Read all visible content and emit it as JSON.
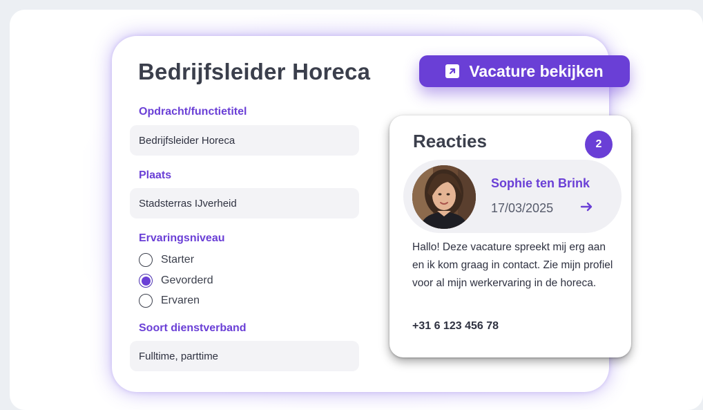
{
  "job": {
    "title": "Bedrijfsleider Horeca",
    "view_button_label": "Vacature bekijken"
  },
  "fields": {
    "functie_label": "Opdracht/functietitel",
    "functie_value": "Bedrijfsleider Horeca",
    "plaats_label": "Plaats",
    "plaats_value": "Stadsterras IJverheid",
    "ervaring_label": "Ervaringsniveau",
    "ervaring_options": [
      "Starter",
      "Gevorderd",
      "Ervaren"
    ],
    "ervaring_selected": "Gevorderd",
    "dienstverband_label": "Soort dienstverband",
    "dienstverband_value": "Fulltime, parttime"
  },
  "reacties": {
    "title": "Reacties",
    "count": "2",
    "person": {
      "name": "Sophie ten Brink",
      "date": "17/03/2025"
    },
    "message": "Hallo! Deze vacature spreekt mij erg aan en ik kom graag in contact. Zie mijn profiel voor al mijn werkervaring in de horeca.",
    "phone": "+31 6 123 456 78"
  },
  "colors": {
    "accent": "#6a3fd6",
    "text": "#3b3f4c",
    "field_bg": "#f3f3f6"
  },
  "icons": {
    "view_button": "external-link-icon",
    "date_row": "arrow-right-icon"
  }
}
